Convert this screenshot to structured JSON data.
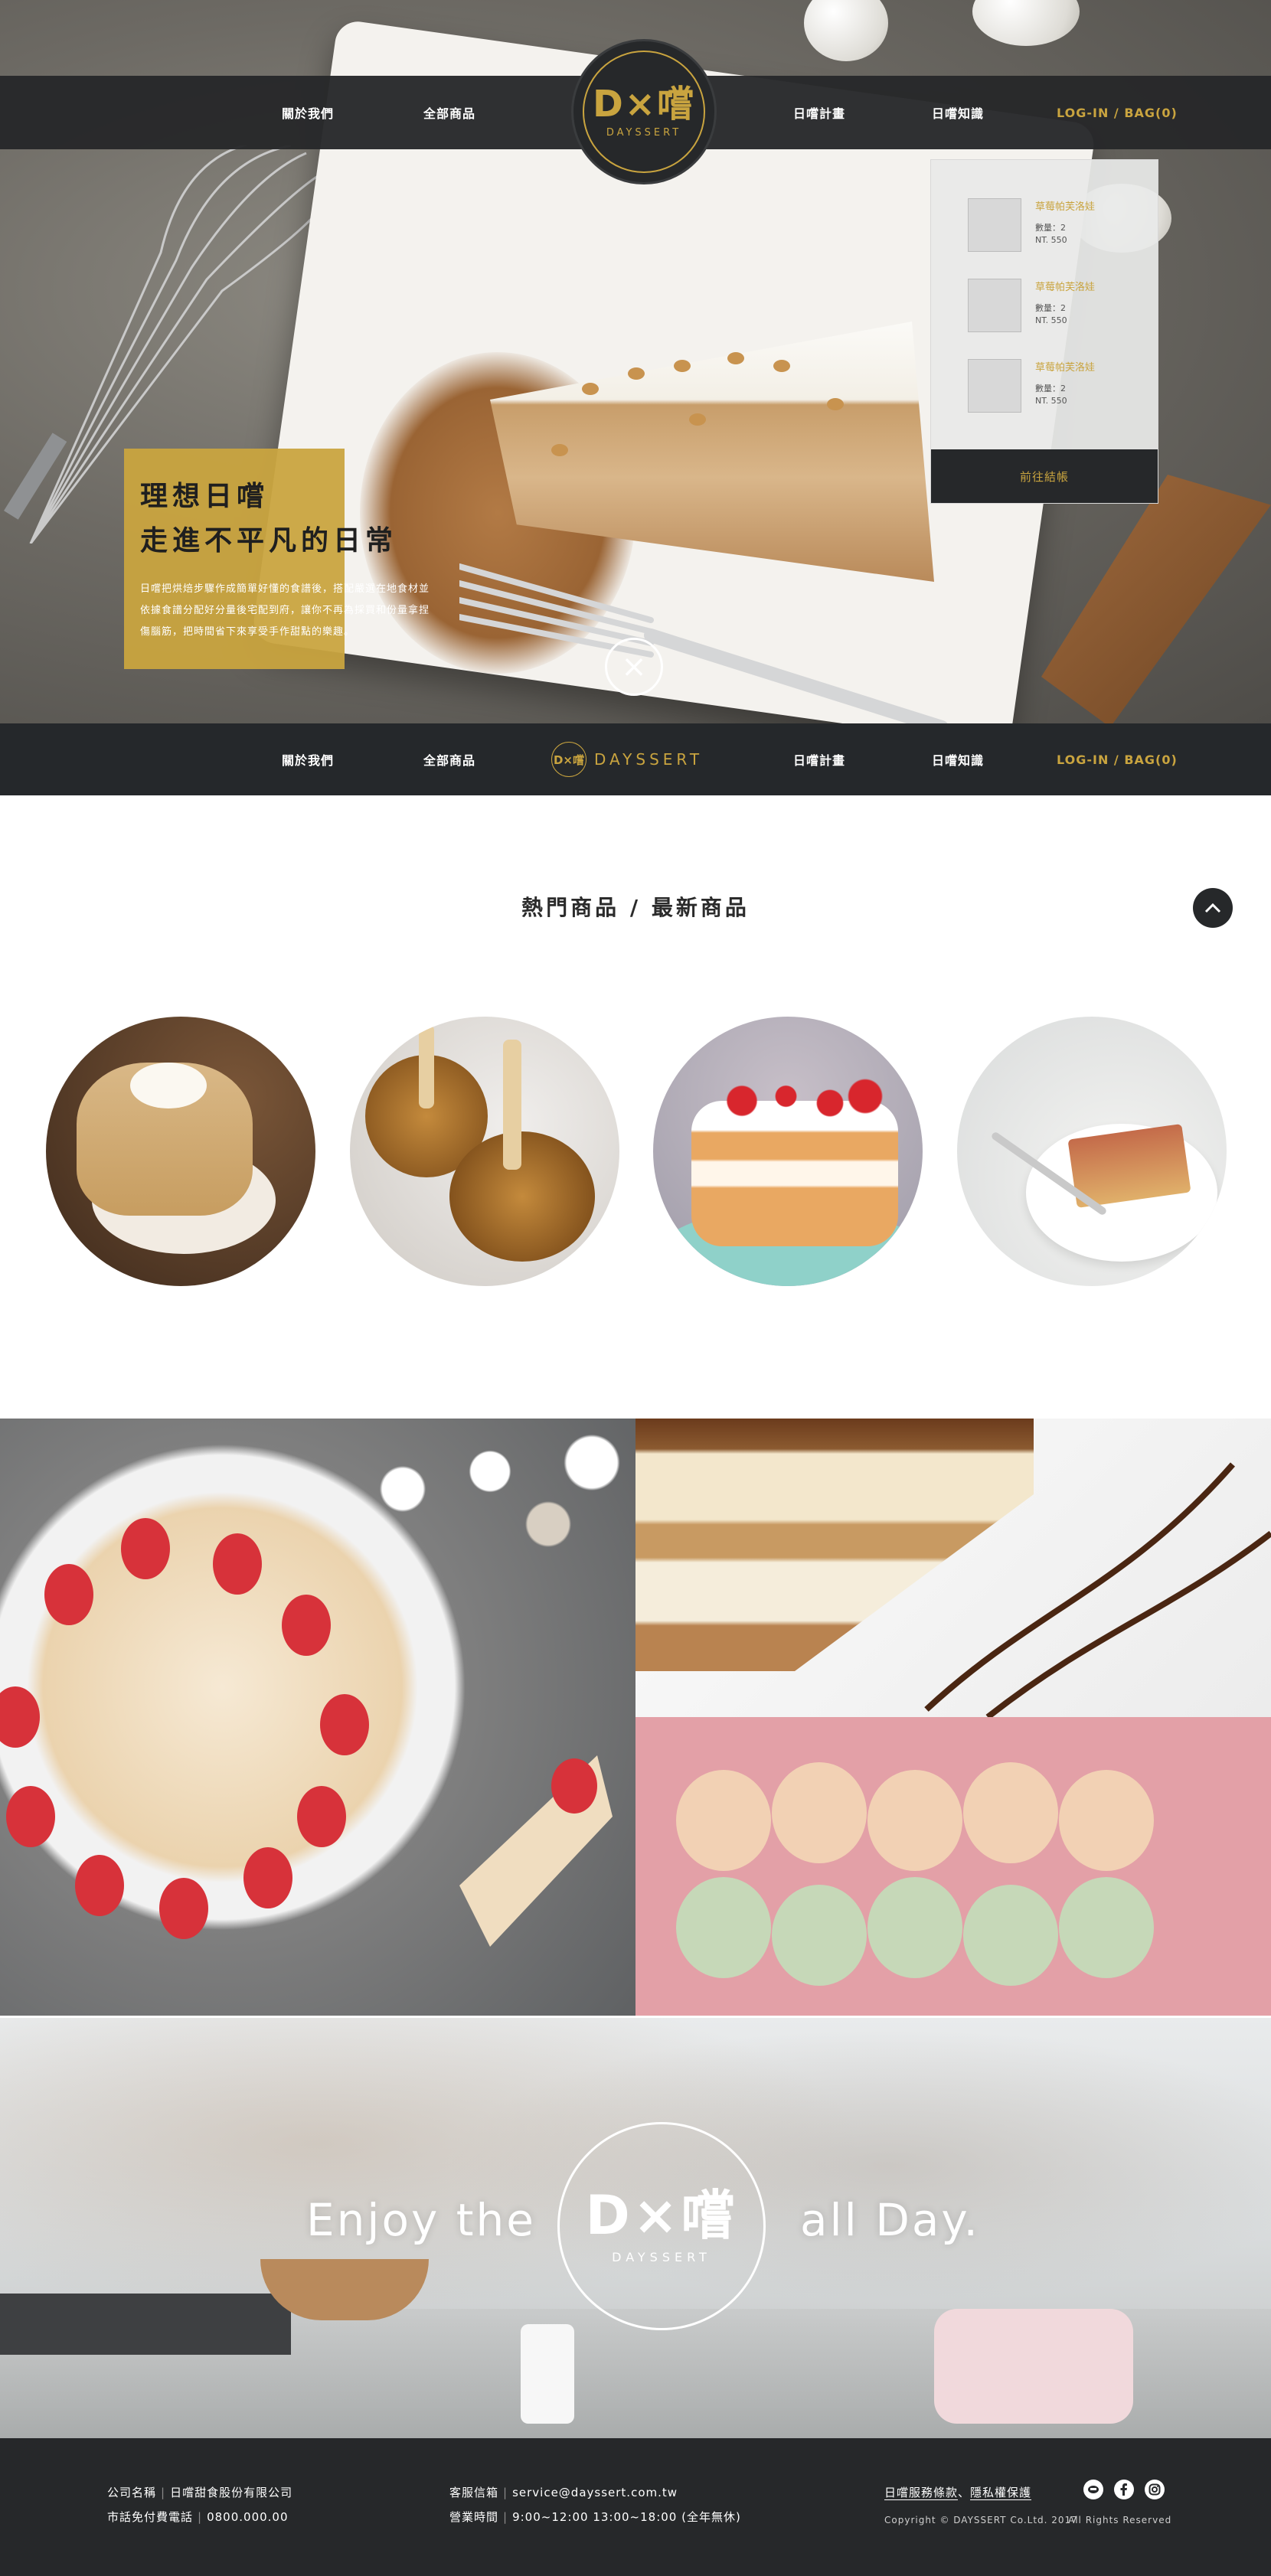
{
  "nav": {
    "about": "關於我們",
    "products": "全部商品",
    "plan": "日嚐計畫",
    "knowledge": "日嚐知識",
    "login_bag": "LOG-IN / BAG(0)"
  },
  "logo": {
    "mark": "D×嚐",
    "sub": "DAYSSERT",
    "small_mark": "D×嚐",
    "word": "DAYSSERT"
  },
  "cart": {
    "items": [
      {
        "name": "草莓帕芙洛娃",
        "qty": "數量：2",
        "price": "NT. 550"
      },
      {
        "name": "草莓帕芙洛娃",
        "qty": "數量：2",
        "price": "NT. 550"
      },
      {
        "name": "草莓帕芙洛娃",
        "qty": "數量：2",
        "price": "NT. 550"
      }
    ],
    "checkout": "前往結帳"
  },
  "hero": {
    "title_line1": "理想日嚐",
    "title_line2": "走進不平凡的日常",
    "description": "日嚐把烘焙步驟作成簡單好懂的食譜後，搭配嚴選在地食材並依據食譜分配好分量後宅配到府，讓你不再為採買和份量拿捏傷腦筋，把時間省下來享受手作甜點的樂趣。",
    "close_symbol": "×"
  },
  "section": {
    "title": "熱門商品 / 最新商品",
    "top_symbol": "︿"
  },
  "banner": {
    "left_text": "Enjoy the",
    "right_text": "all Day.",
    "mark": "D×嚐",
    "sub": "DAYSSERT"
  },
  "footer": {
    "company_label": "公司名稱",
    "company_value": "日嚐甜食股份有限公司",
    "phone_label": "市話免付費電話",
    "phone_value": "0800.000.00",
    "email_label": "客服信箱",
    "email_value": "service@dayssert.com.tw",
    "hours_label": "營業時間",
    "hours_value": "9:00~12:00 13:00~18:00 (全年無休)",
    "terms": "日嚐服務條款",
    "privacy": "隱私權保護",
    "terms_sep": "、",
    "copyright": "Copyright © DAYSSERT Co.Ltd. 2017",
    "rights": "All Rights Reserved",
    "sep": "|"
  },
  "colors": {
    "gold": "#c9a43f",
    "dark": "#26282a",
    "white": "#ffffff"
  },
  "icons": {
    "line": "line-icon",
    "facebook": "facebook-icon",
    "instagram": "instagram-icon",
    "close": "close-icon",
    "back_to_top": "chevron-up-icon"
  }
}
